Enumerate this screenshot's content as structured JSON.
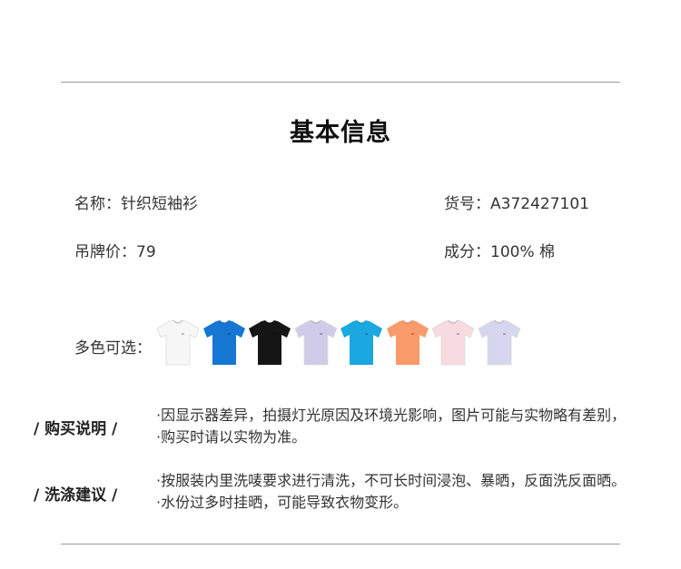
{
  "title": "基本信息",
  "info": {
    "name": "名称：针织短袖衫",
    "sku": "货号：A372427101",
    "price": "吊牌价：79",
    "composition": "成分：100% 棉"
  },
  "colors": {
    "label": "多色可选：",
    "swatches": [
      {
        "name": "white-shirt",
        "color": "#f7f7f7"
      },
      {
        "name": "blue-shirt",
        "color": "#1677d2"
      },
      {
        "name": "black-shirt",
        "color": "#151515"
      },
      {
        "name": "lavender-shirt",
        "color": "#cfcbe8"
      },
      {
        "name": "cyan-shirt",
        "color": "#1ba7e0"
      },
      {
        "name": "orange-shirt",
        "color": "#f99a6b"
      },
      {
        "name": "pink-shirt",
        "color": "#f6dbe0"
      },
      {
        "name": "light-lavender-shirt",
        "color": "#d6d6ee"
      }
    ]
  },
  "purchase_notes": {
    "label": "/ 购买说明 /",
    "lines": [
      "·因显示器差异，拍摄灯光原因及环境光影响，图片可能与实物略有差别，",
      "·购买时请以实物为准。"
    ]
  },
  "washing_notes": {
    "label": "/ 洗涤建议 /",
    "lines": [
      "·按服装内里洗唛要求进行清洗，不可长时间浸泡、暴晒，反面洗反面晒。",
      "·水份过多时挂晒，可能导致衣物变形。"
    ]
  }
}
